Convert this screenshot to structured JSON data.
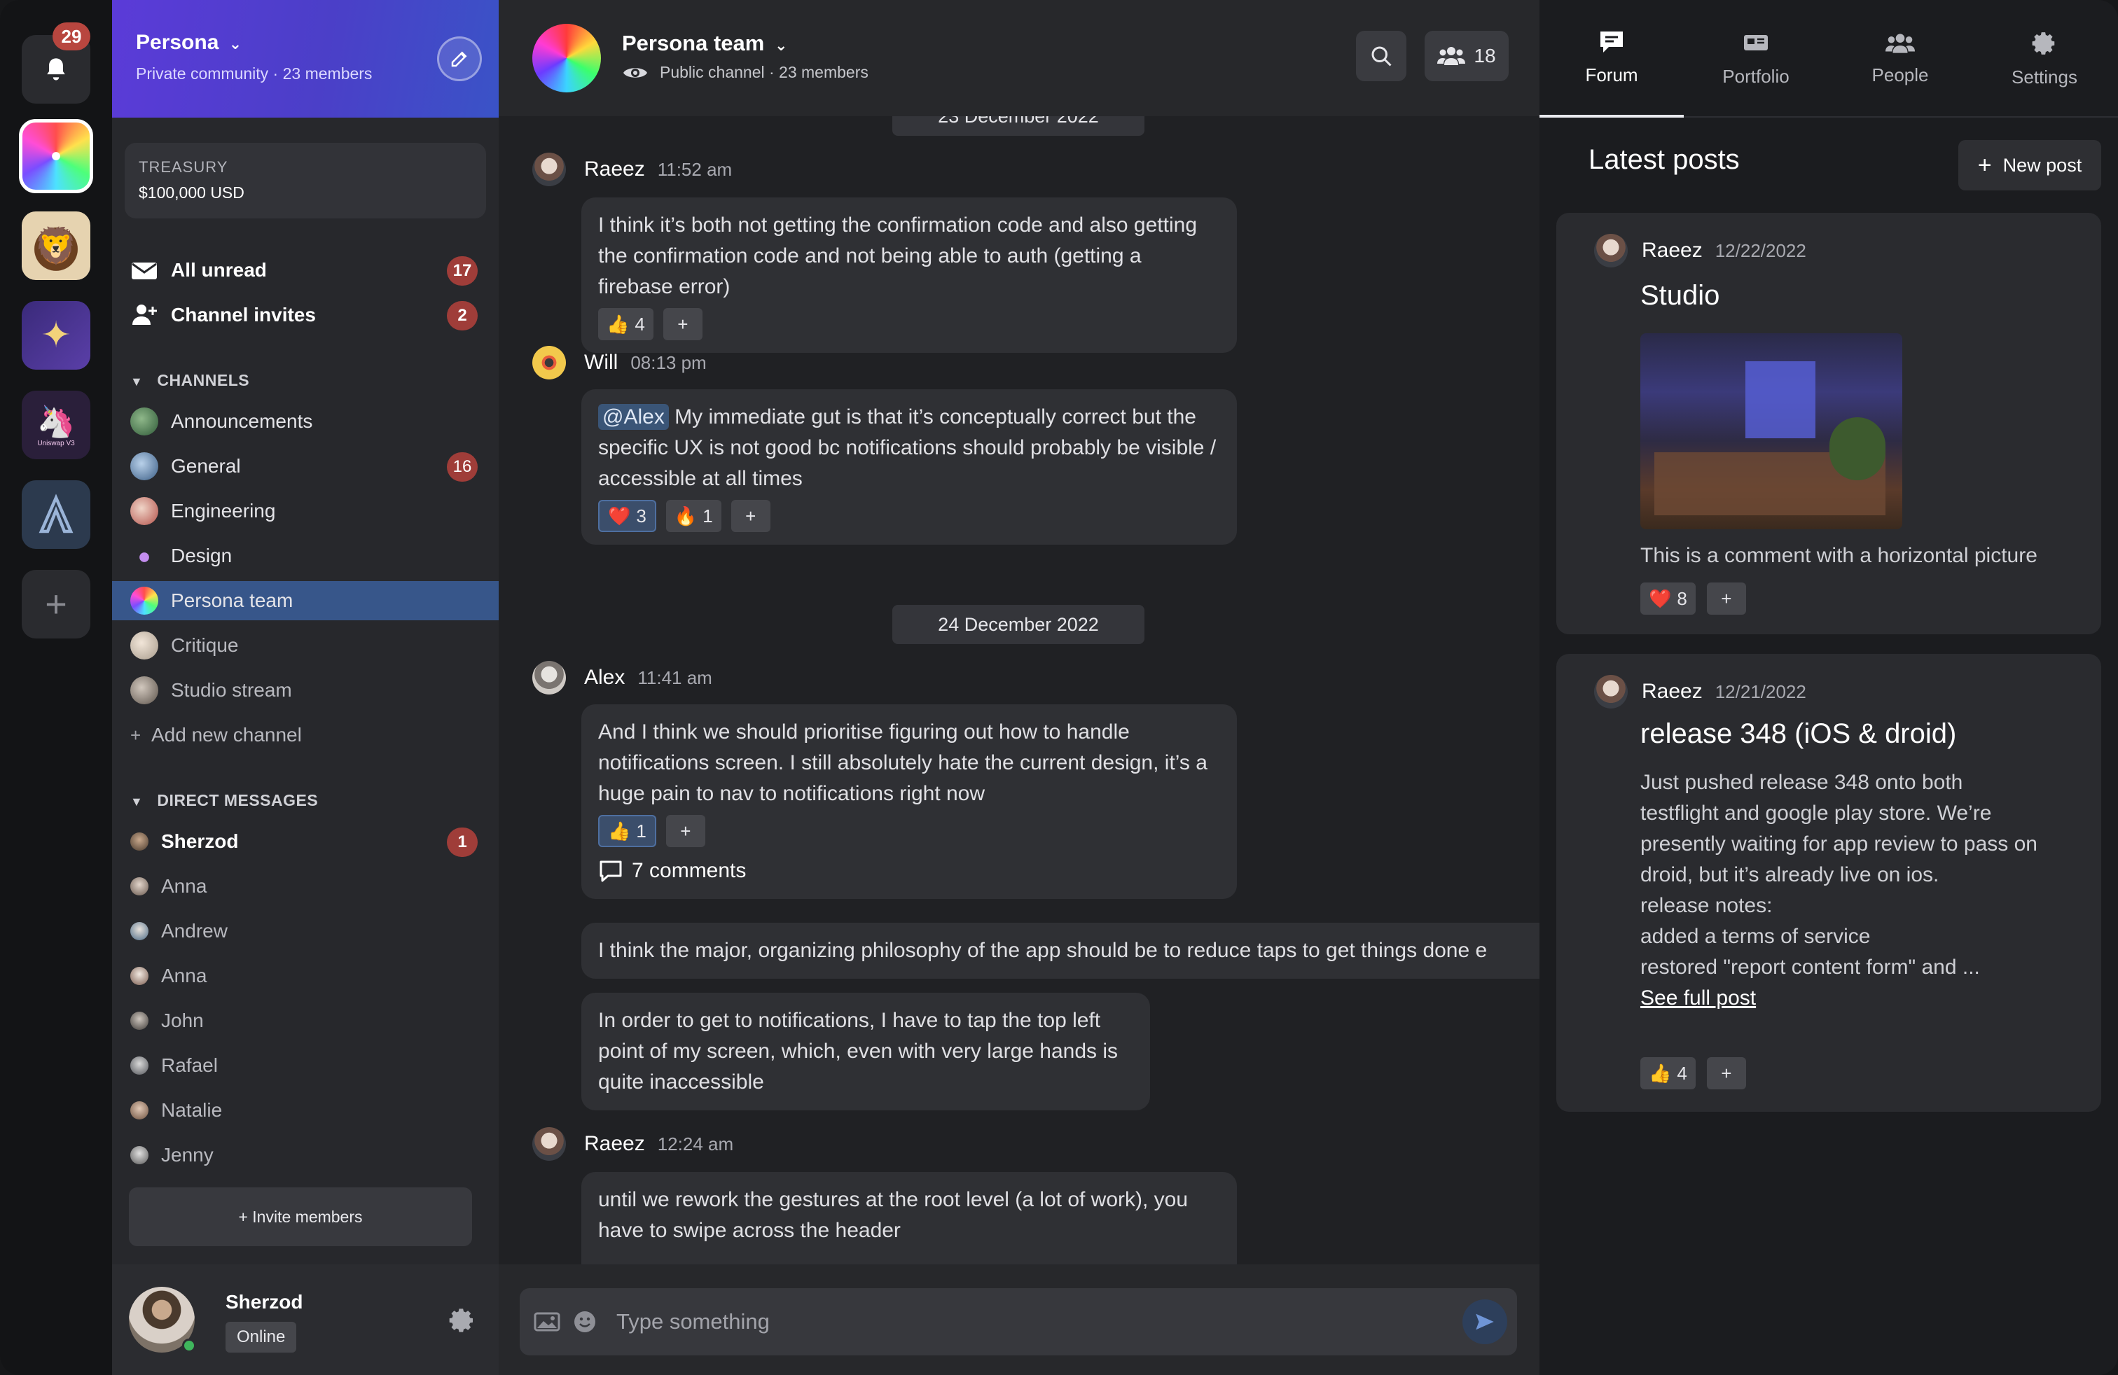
{
  "rail": {
    "notifications_count": "29",
    "apps": [
      "persona-community",
      "lion-community",
      "sparkles-community",
      "uniswap-community",
      "arbitrum-community"
    ],
    "uniswap_label": "Uniswap V3"
  },
  "community": {
    "name": "Persona",
    "meta": "Private community · 23 members"
  },
  "treasury": {
    "label": "TREASURY",
    "value": "$100,000 USD"
  },
  "quick": [
    {
      "label": "All unread",
      "badge": "17"
    },
    {
      "label": "Channel invites",
      "badge": "2"
    }
  ],
  "channels": {
    "title": "CHANNELS",
    "items": [
      {
        "label": "Announcements",
        "badge": ""
      },
      {
        "label": "General",
        "badge": "16"
      },
      {
        "label": "Engineering",
        "badge": ""
      },
      {
        "label": "Design",
        "badge": ""
      },
      {
        "label": "Persona team",
        "badge": ""
      },
      {
        "label": "Critique",
        "badge": ""
      },
      {
        "label": "Studio stream",
        "badge": ""
      }
    ],
    "add_label": "Add new channel"
  },
  "dms": {
    "title": "DIRECT MESSAGES",
    "items": [
      {
        "label": "Sherzod",
        "badge": "1"
      },
      {
        "label": "Anna",
        "badge": ""
      },
      {
        "label": "Andrew",
        "badge": ""
      },
      {
        "label": "Anna",
        "badge": ""
      },
      {
        "label": "John",
        "badge": ""
      },
      {
        "label": "Rafael",
        "badge": ""
      },
      {
        "label": "Natalie",
        "badge": ""
      },
      {
        "label": "Jenny",
        "badge": ""
      }
    ]
  },
  "invite_label": "+ Invite members",
  "user": {
    "name": "Sherzod",
    "status": "Online"
  },
  "channel": {
    "name": "Persona team",
    "meta": "Public channel · 23 members",
    "members_count": "18"
  },
  "dates": [
    "23 December 2022",
    "24 December 2022"
  ],
  "messages": [
    {
      "author": "Raeez",
      "time": "11:52 am",
      "text": "I think it’s both not getting the confirmation code and also getting the confirmation code and not being able to auth (getting a firebase error)",
      "reactions": [
        {
          "emoji": "👍",
          "count": "4"
        }
      ]
    },
    {
      "author": "Will",
      "time": "08:13 pm",
      "mention": "@Alex",
      "text": "My immediate gut is that it’s conceptually correct but the specific UX is not good bc notifications should probably be visible / accessible at all times",
      "reactions": [
        {
          "emoji": "❤️",
          "count": "3"
        },
        {
          "emoji": "🔥",
          "count": "1"
        }
      ]
    },
    {
      "author": "Alex",
      "time": "11:41 am",
      "text": "And I think we should prioritise figuring out how to handle notifications screen. I still absolutely hate the current design, it’s a huge pain to nav to notifications right now",
      "reactions": [
        {
          "emoji": "👍",
          "count": "1"
        }
      ],
      "comments": "7 comments"
    },
    {
      "text": "I think the major, organizing philosophy of the app should be to reduce taps to get things done e"
    },
    {
      "text": "In order to get to notifications, I have to tap the top left point of my screen, which, even with very large hands is quite inaccessible"
    },
    {
      "author": "Raeez",
      "time": "12:24 am",
      "text": "until we rework the gestures at the root level (a lot of work), you have to swipe across the header"
    }
  ],
  "composer": {
    "placeholder": "Type something"
  },
  "tabs": [
    {
      "label": "Forum",
      "icon": "forum-icon"
    },
    {
      "label": "Portfolio",
      "icon": "portfolio-icon"
    },
    {
      "label": "People",
      "icon": "people-icon"
    },
    {
      "label": "Settings",
      "icon": "gear-icon"
    }
  ],
  "forum": {
    "title": "Latest posts",
    "new_post": "New post",
    "posts": [
      {
        "author": "Raeez",
        "date": "12/22/2022",
        "title": "Studio",
        "body": "This is a comment with a horizontal picture",
        "reaction": {
          "emoji": "❤️",
          "count": "8"
        }
      },
      {
        "author": "Raeez",
        "date": "12/21/2022",
        "title": "release 348 (iOS & droid)",
        "body": "Just pushed release 348 onto both testflight and google play store. We’re presently waiting for app review to pass on droid, but it’s already live on ios.",
        "notes_label": "release notes:",
        "note1": "added a terms of service",
        "note2": "restored \"report content form\" and ...",
        "link": "See full post",
        "reaction": {
          "emoji": "👍",
          "count": "4"
        }
      }
    ]
  },
  "colors": {
    "accent": "#37568a",
    "badge": "#9f3d39",
    "community_gradient_start": "#5b3bd8",
    "community_gradient_end": "#3a53c7"
  }
}
